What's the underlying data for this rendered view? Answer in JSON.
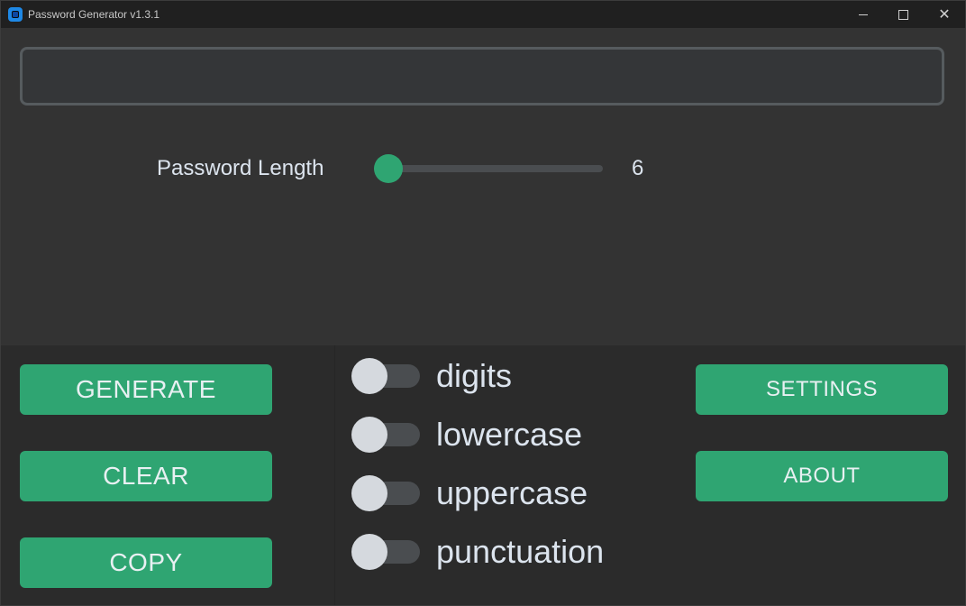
{
  "window": {
    "title": "Password Generator v1.3.1",
    "icon": "app-icon",
    "controls": {
      "minimize_icon": "minimize-icon",
      "maximize_icon": "maximize-icon",
      "close_icon": "close-icon",
      "close_glyph": "✕"
    }
  },
  "password": {
    "value": "",
    "placeholder": ""
  },
  "length": {
    "label": "Password Length",
    "value": "6",
    "slider_fraction": 0
  },
  "buttons": {
    "generate": "GENERATE",
    "clear": "CLEAR",
    "copy": "COPY",
    "settings": "SETTINGS",
    "about": "ABOUT"
  },
  "options": [
    {
      "label": "digits",
      "checked": false
    },
    {
      "label": "lowercase",
      "checked": false
    },
    {
      "label": "uppercase",
      "checked": false
    },
    {
      "label": "punctuation",
      "checked": false
    }
  ],
  "colors": {
    "accent": "#2fa572",
    "background": "#2b2b2b",
    "panel": "#333333",
    "text": "#dce4ee"
  }
}
